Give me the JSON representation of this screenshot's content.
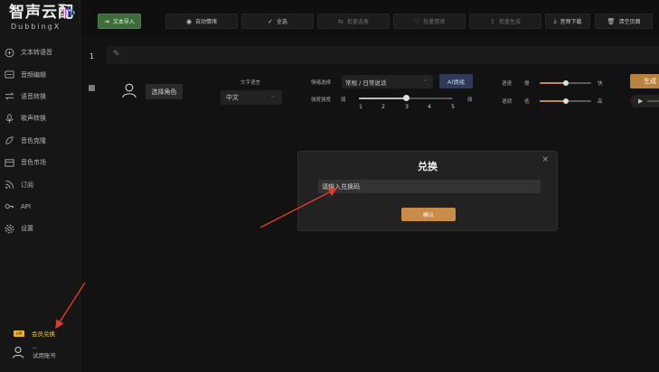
{
  "app": {
    "logo_text": "智声云配",
    "logo_sub": "DubbingX",
    "accent": "#c98b48"
  },
  "sidebar": {
    "items": [
      {
        "label": "文本转语音",
        "icon": "text-to-speech-icon"
      },
      {
        "label": "音频编辑",
        "icon": "audio-edit-icon"
      },
      {
        "label": "语音转换",
        "icon": "voice-convert-icon"
      },
      {
        "label": "歌声转换",
        "icon": "singing-voice-icon"
      },
      {
        "label": "音色克隆",
        "icon": "voice-clone-icon"
      },
      {
        "label": "音色市场",
        "icon": "voice-market-icon"
      },
      {
        "label": "订阅",
        "icon": "rss-icon"
      },
      {
        "label": "API",
        "icon": "api-key-icon"
      },
      {
        "label": "设置",
        "icon": "settings-gear-icon"
      }
    ],
    "vip_label": "会员兑换",
    "vip_badge": "VIP",
    "user_name_line1": "--",
    "user_name_line2": "试用账号"
  },
  "toolbar": {
    "buttons": [
      {
        "label": "文本导入",
        "icon": "import-icon",
        "symbol": "⇥"
      },
      {
        "label": "自动情绪",
        "icon": "emotion-icon",
        "symbol": "◉"
      },
      {
        "label": "全选",
        "icon": "check-icon",
        "symbol": "✓"
      },
      {
        "label": "批量选角",
        "icon": "cast-icon",
        "symbol": "⇆"
      },
      {
        "label": "批量情绪",
        "icon": "batch-emotion-icon",
        "symbol": "♡"
      },
      {
        "label": "批量生成",
        "icon": "batch-generate-icon",
        "symbol": "⇪"
      },
      {
        "label": "音频下载",
        "icon": "download-icon",
        "symbol": "⤓"
      },
      {
        "label": "清空页面",
        "icon": "trash-icon",
        "symbol": "🗑"
      }
    ]
  },
  "editor": {
    "row_number": "1",
    "role_button": "选择角色",
    "lang_label": "文字语言",
    "lang_value": "中文",
    "emotion_label": "情绪选择",
    "emotion_value": "常规 / 日常说话",
    "ai_button": "AI情绪",
    "intensity_label": "强度强度",
    "intensity_weak": "弱",
    "intensity_strong": "强",
    "intensity_ticks": [
      "1",
      "2",
      "3",
      "4",
      "5"
    ],
    "intensity_value": 3,
    "speed_label": "语速",
    "speed_low": "慢",
    "speed_high": "快",
    "speed_value": 0.5,
    "pitch_label": "语调",
    "pitch_low": "低",
    "pitch_high": "高",
    "pitch_value": 0.5,
    "generate_button": "生成"
  },
  "modal": {
    "title": "兑换",
    "placeholder": "请输入兑换码",
    "confirm": "确认",
    "close": "×"
  }
}
